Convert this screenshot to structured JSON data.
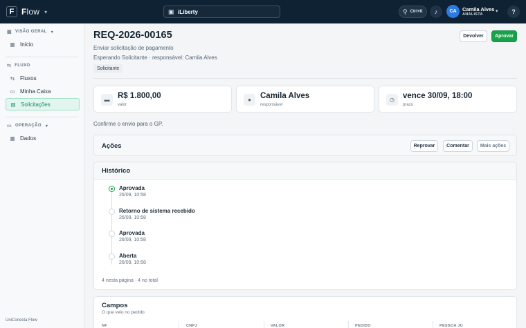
{
  "topbar": {
    "logo_letter": "F",
    "brand_prefix": "F",
    "brand_rest": "low",
    "tenant": "iLiberty",
    "search_shortcut": "Ctrl+K",
    "user_initials": "CA",
    "user_name": "Camila Alves",
    "user_role": "ANALISTA"
  },
  "sidebar": {
    "section_overview": "VISÃO GERAL",
    "item_home": "Início",
    "section_flow": "FLUXO",
    "item_flows": "Fluxos",
    "item_inbox": "Minha Caixa",
    "item_requests": "Solicitações",
    "section_ops": "OPERAÇÃO",
    "item_data": "Dados",
    "footer": "UniConecta Flow"
  },
  "request": {
    "id": "REQ-2026-00165",
    "subtitle": "Enviar solicitação de pagamento",
    "status_line": "Esperando Solicitante · responsável: Camila Alves",
    "tag": "Solicitante",
    "return_button": "Devolver",
    "approve_button": "Aprovar"
  },
  "stats": [
    {
      "value": "R$ 1.800,00",
      "label": "valor",
      "icon": "money-icon"
    },
    {
      "value": "Camila Alves",
      "label": "responsável",
      "icon": "user-icon"
    },
    {
      "value": "vence 30/09, 18:00",
      "label": "prazo",
      "icon": "clock-icon"
    }
  ],
  "confirm_text": "Confirme o envio para o GP.",
  "actions": {
    "title": "Ações",
    "reject": "Reprovar",
    "comment": "Comentar",
    "more": "Mais ações"
  },
  "history": {
    "title": "Histórico",
    "events": [
      {
        "title": "Aprovada",
        "time": "26/09, 10:58"
      },
      {
        "title": "Retorno de sistema recebido",
        "time": "26/09, 10:58"
      },
      {
        "title": "Aprovada",
        "time": "26/09, 10:58"
      },
      {
        "title": "Aberta",
        "time": "26/09, 10:58"
      }
    ],
    "footer": "4 nesta página · 4 no total"
  },
  "fields": {
    "title": "Campos",
    "subtitle": "O que veio no pedido",
    "columns": [
      "NF",
      "CNPJ",
      "VALOR",
      "PEDIDO",
      "PESSOA JU"
    ]
  },
  "colors": {
    "topbar": "#0f2233",
    "accent_green": "#16a34a",
    "active_nav_bg": "#e2f6ef",
    "avatar": "#2c7be5"
  }
}
